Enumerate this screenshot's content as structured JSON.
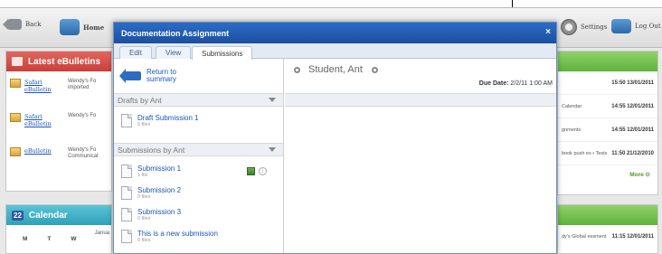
{
  "background": {
    "header": {
      "back_label": "Back",
      "home_label": "Home",
      "settings_label": "Settings",
      "logout_label": "Log Out"
    },
    "ebulletins": {
      "title": "Latest eBulletins",
      "items": [
        {
          "link": "Safari eBulletin",
          "desc": "Wendy's Fo imported"
        },
        {
          "link": "Safari eBulletin",
          "desc": "Wendy's Fo"
        },
        {
          "link": "eBulletin",
          "desc": "Wendy's Fo Communicat"
        }
      ]
    },
    "calendar": {
      "badge": "22",
      "title": "Calendar",
      "month": "Janua",
      "days": [
        "M",
        "T",
        "W"
      ]
    },
    "right_panel": {
      "rows": [
        {
          "label": "",
          "time": "15:50 13/01/2011"
        },
        {
          "label": "Calendar",
          "time": "14:55 12/01/2011"
        },
        {
          "label": "gnments",
          "time": "14:55 12/01/2011"
        },
        {
          "label": "book push es • Tests",
          "time": "11:50 21/12/2010"
        }
      ],
      "more": "More",
      "row2": {
        "label": "dy's Global essment",
        "time": "11:15 12/01/2011"
      }
    }
  },
  "modal": {
    "title": "Documentation Assignment",
    "close": "×",
    "tabs": [
      "Edit",
      "View",
      "Submissions"
    ],
    "return_label": "Return to summary",
    "drafts_header": "Drafts by Ant",
    "drafts": [
      {
        "name": "Draft Submission 1",
        "files": "0 files"
      }
    ],
    "submissions_header": "Submissions by Ant",
    "submissions": [
      {
        "name": "Submission 1",
        "files": "1 file"
      },
      {
        "name": "Submission 2",
        "files": "0 files"
      },
      {
        "name": "Submission 3",
        "files": "0 files"
      },
      {
        "name": "This is a new submission",
        "files": "0 files"
      }
    ],
    "student": "Student, Ant",
    "due_label": "Due Date:",
    "due_value": "2/2/11 1:00 AM"
  }
}
